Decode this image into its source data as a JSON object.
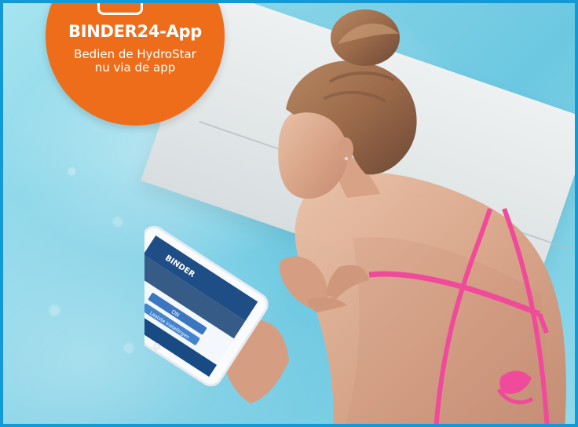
{
  "badge": {
    "title": "BINDER24-App",
    "subtitle_line1": "Bedien de HydroStar",
    "subtitle_line2": "nu via de app",
    "color": "#ee6d1b"
  },
  "colors": {
    "frame": "#1399d6",
    "water": "#80d1e6",
    "deck": "#d8dee0",
    "swimsuit": "#f04b9a"
  },
  "tablet_screen": {
    "brand": "BINDER",
    "button_1": "ON",
    "button_2": "Laatste instellingen"
  }
}
